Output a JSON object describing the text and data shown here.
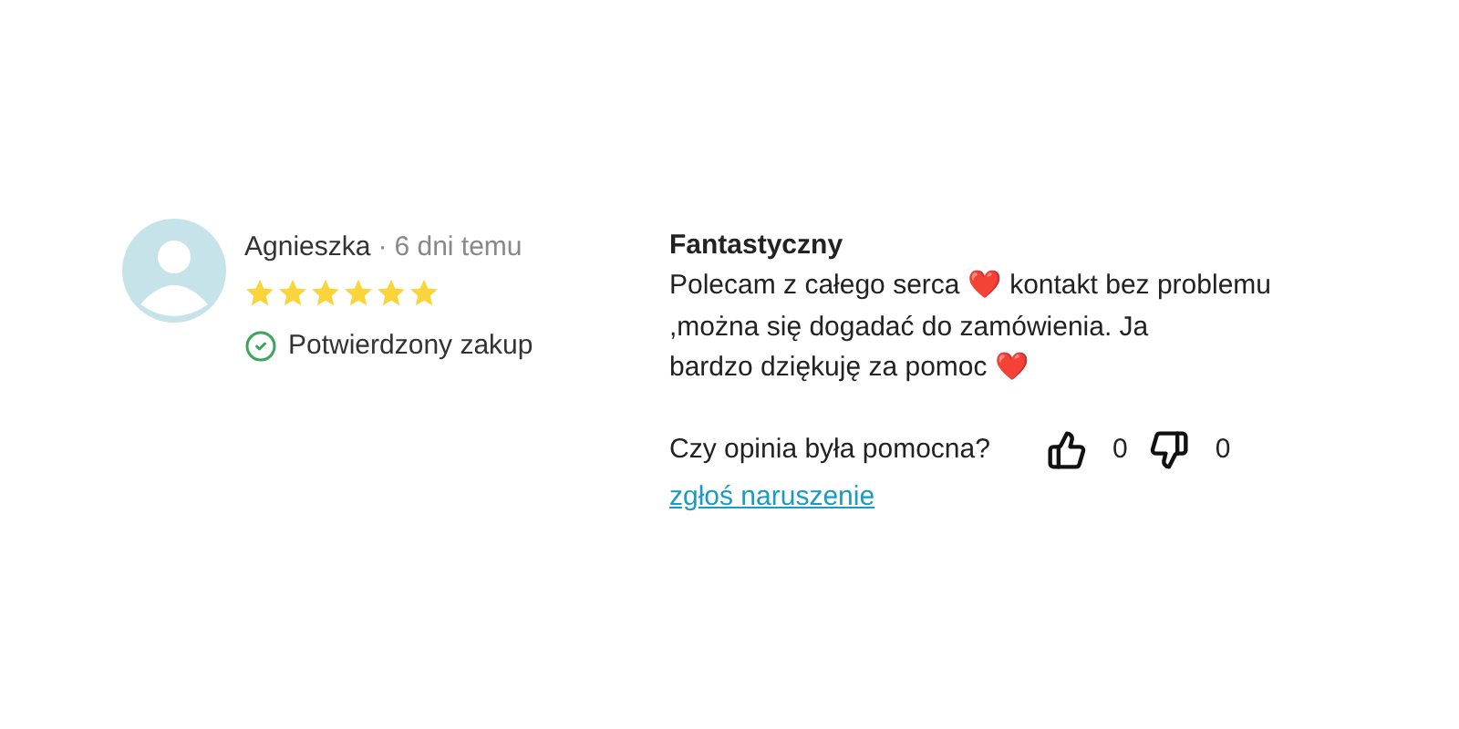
{
  "review": {
    "author": "Agnieszka",
    "separator": "·",
    "date": "6 dni temu",
    "stars": 6,
    "verified": {
      "label": "Potwierdzony zakup"
    },
    "title": "Fantastyczny",
    "body_lines": [
      "Polecam z całego serca ❤️ kontakt bez problemu",
      ",można się dogadać do zamówienia. Ja",
      "bardzo dziękuję za pomoc ❤️"
    ],
    "helpful": {
      "question": "Czy opinia była pomocna?",
      "up_count": "0",
      "down_count": "0"
    },
    "report_link": "zgłoś naruszenie"
  }
}
